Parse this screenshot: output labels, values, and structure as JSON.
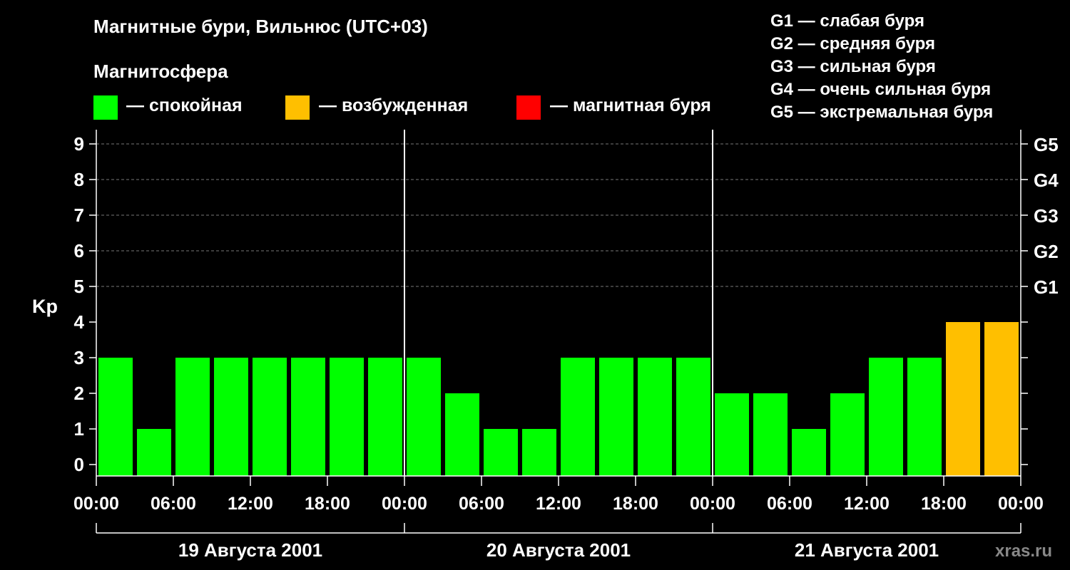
{
  "title": "Магнитные бури, Вильнюс (UTC+03)",
  "subtitle": "Магнитосфера",
  "legend": [
    {
      "color": "#00ff00",
      "label": "— спокойная"
    },
    {
      "color": "#ffbf00",
      "label": "— возбужденная"
    },
    {
      "color": "#ff0000",
      "label": "— магнитная буря"
    }
  ],
  "g_legend": [
    "G1 — слабая буря",
    "G2 — средняя буря",
    "G3 — сильная буря",
    "G4 — очень сильная буря",
    "G5 — экстремальная буря"
  ],
  "watermark": "xras.ru",
  "chart_data": {
    "type": "bar",
    "ylabel": "Kp",
    "ylim": [
      0,
      9
    ],
    "yticks": [
      "0",
      "1",
      "2",
      "3",
      "4",
      "5",
      "6",
      "7",
      "8",
      "9"
    ],
    "right_ticks": [
      {
        "value": 5,
        "label": "G1"
      },
      {
        "value": 6,
        "label": "G2"
      },
      {
        "value": 7,
        "label": "G3"
      },
      {
        "value": 8,
        "label": "G4"
      },
      {
        "value": 9,
        "label": "G5"
      }
    ],
    "x_tick_labels": [
      "00:00",
      "06:00",
      "12:00",
      "18:00",
      "00:00",
      "06:00",
      "12:00",
      "18:00",
      "00:00",
      "06:00",
      "12:00",
      "18:00",
      "00:00"
    ],
    "days": [
      "19 Августа 2001",
      "20 Августа 2001",
      "21 Августа 2001"
    ],
    "interval_hours": 3,
    "values": [
      3,
      1,
      3,
      3,
      3,
      3,
      3,
      3,
      3,
      2,
      1,
      1,
      3,
      3,
      3,
      3,
      2,
      2,
      1,
      2,
      3,
      3,
      4,
      4
    ],
    "colors": [
      "#00ff00",
      "#00ff00",
      "#00ff00",
      "#00ff00",
      "#00ff00",
      "#00ff00",
      "#00ff00",
      "#00ff00",
      "#00ff00",
      "#00ff00",
      "#00ff00",
      "#00ff00",
      "#00ff00",
      "#00ff00",
      "#00ff00",
      "#00ff00",
      "#00ff00",
      "#00ff00",
      "#00ff00",
      "#00ff00",
      "#00ff00",
      "#00ff00",
      "#ffbf00",
      "#ffbf00"
    ],
    "grid": true
  }
}
